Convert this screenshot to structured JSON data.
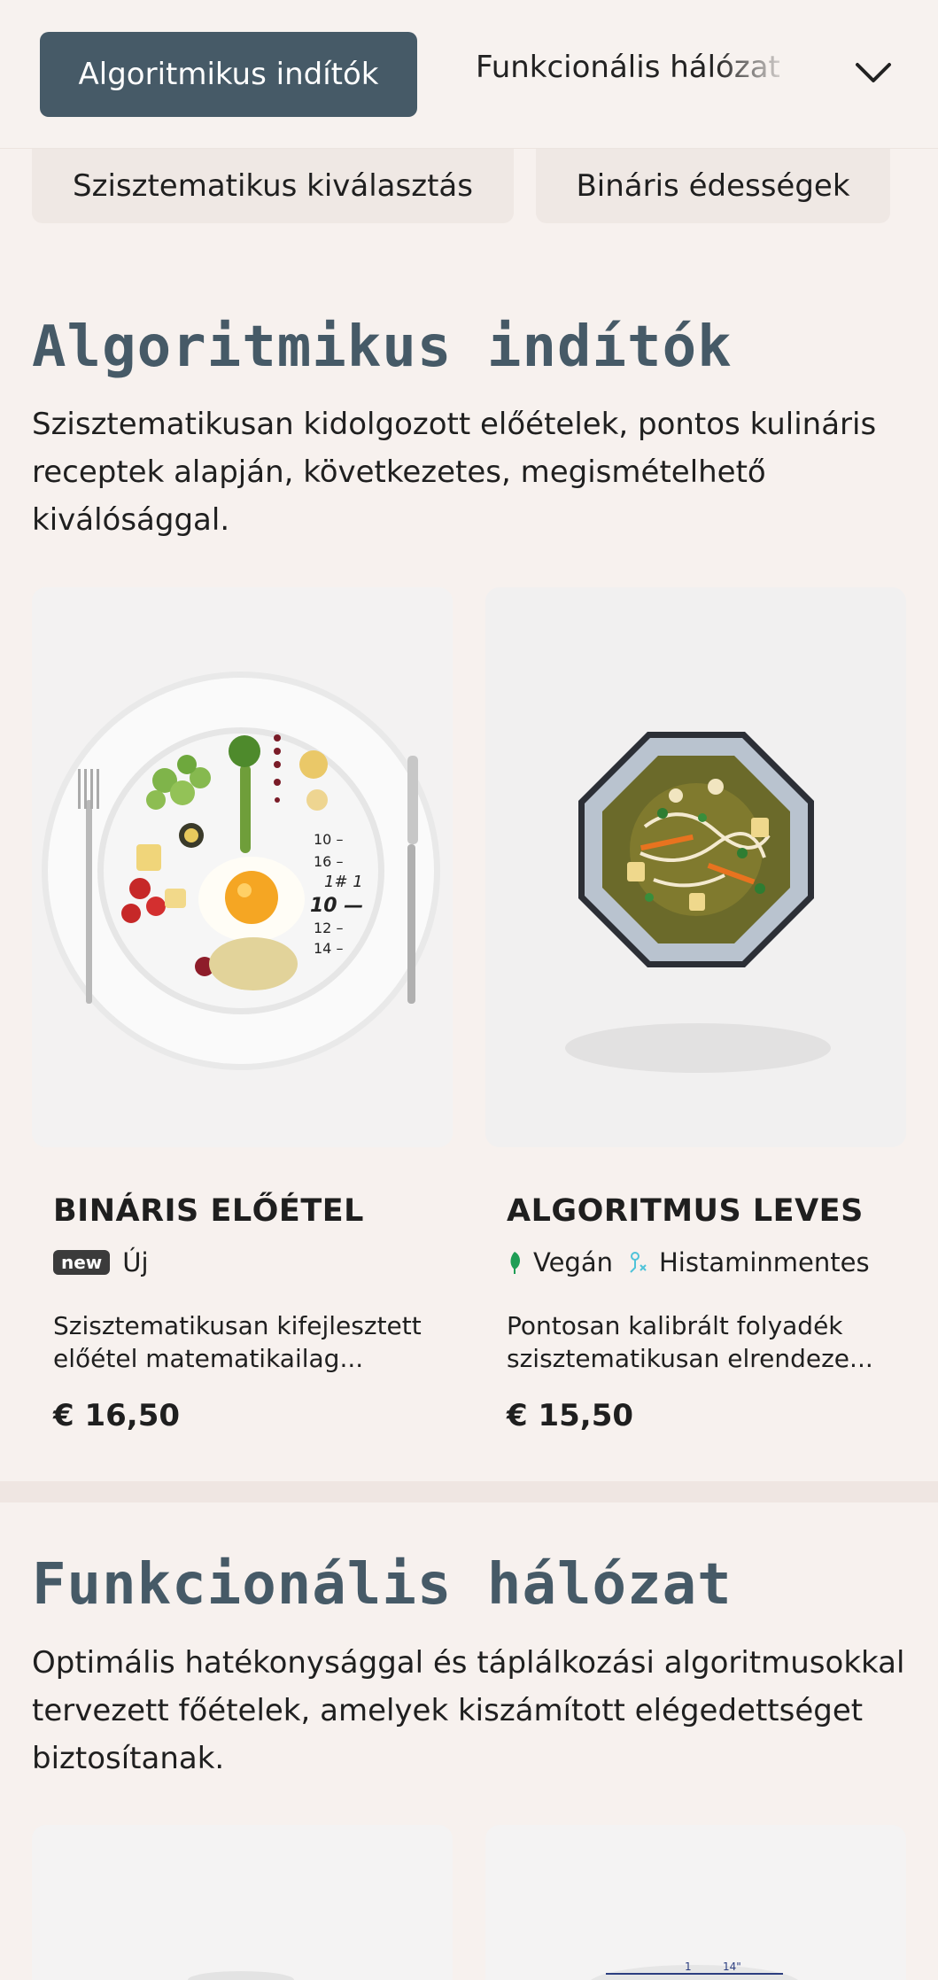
{
  "tabs": {
    "active_label": "Algoritmikus indítók",
    "second_label": "Funkcionális hálózat",
    "chips": [
      "Szisztematikus kiválasztás",
      "Bináris édességek"
    ]
  },
  "sections": [
    {
      "title": "Algoritmikus indítók",
      "description": "Szisztematikusan kidolgozott előételek, pontos kulináris receptek alapján, következetes, megismételhető kiválósággal.",
      "items": [
        {
          "name": "BINÁRIS ELŐÉTEL",
          "badge": "new",
          "tag": "Új",
          "description": "Szisztematikusan kifejlesztett előétel matematikailag...",
          "price": "€ 16,50"
        },
        {
          "name": "ALGORITMUS LEVES",
          "tag1": "Vegán",
          "tag2": "Histaminmentes",
          "description": "Pontosan kalibrált folyadék szisztematikusan elrendeze...",
          "price": "€ 15,50"
        }
      ]
    },
    {
      "title": "Funkcionális hálózat",
      "description": "Optimális hatékonysággal és táplálkozási algoritmusokkal tervezett főételek, amelyek kiszámított elégedettséget biztosítanak."
    }
  ],
  "colors": {
    "accent": "#465a67",
    "background": "#f7f1ee",
    "vegan_icon": "#1f9d55",
    "histamine_icon": "#4fc3d9"
  },
  "icons": [
    "chevron-down-icon",
    "leaf-icon",
    "histamine-free-icon"
  ]
}
